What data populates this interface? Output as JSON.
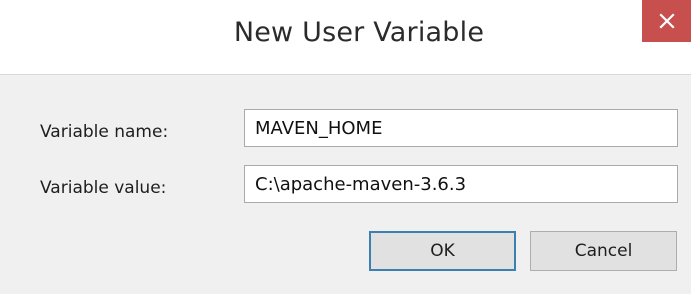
{
  "window": {
    "title": "New User Variable",
    "close_icon": "close-icon"
  },
  "form": {
    "name_label": "Variable name:",
    "name_value": "MAVEN_HOME",
    "value_label": "Variable value:",
    "value_value": "C:\\apache-maven-3.6.3"
  },
  "buttons": {
    "ok_label": "OK",
    "cancel_label": "Cancel"
  },
  "colors": {
    "close_button_bg": "#c7504f",
    "default_button_border": "#3c7fb1",
    "dialog_body_bg": "#f0f0f0"
  }
}
